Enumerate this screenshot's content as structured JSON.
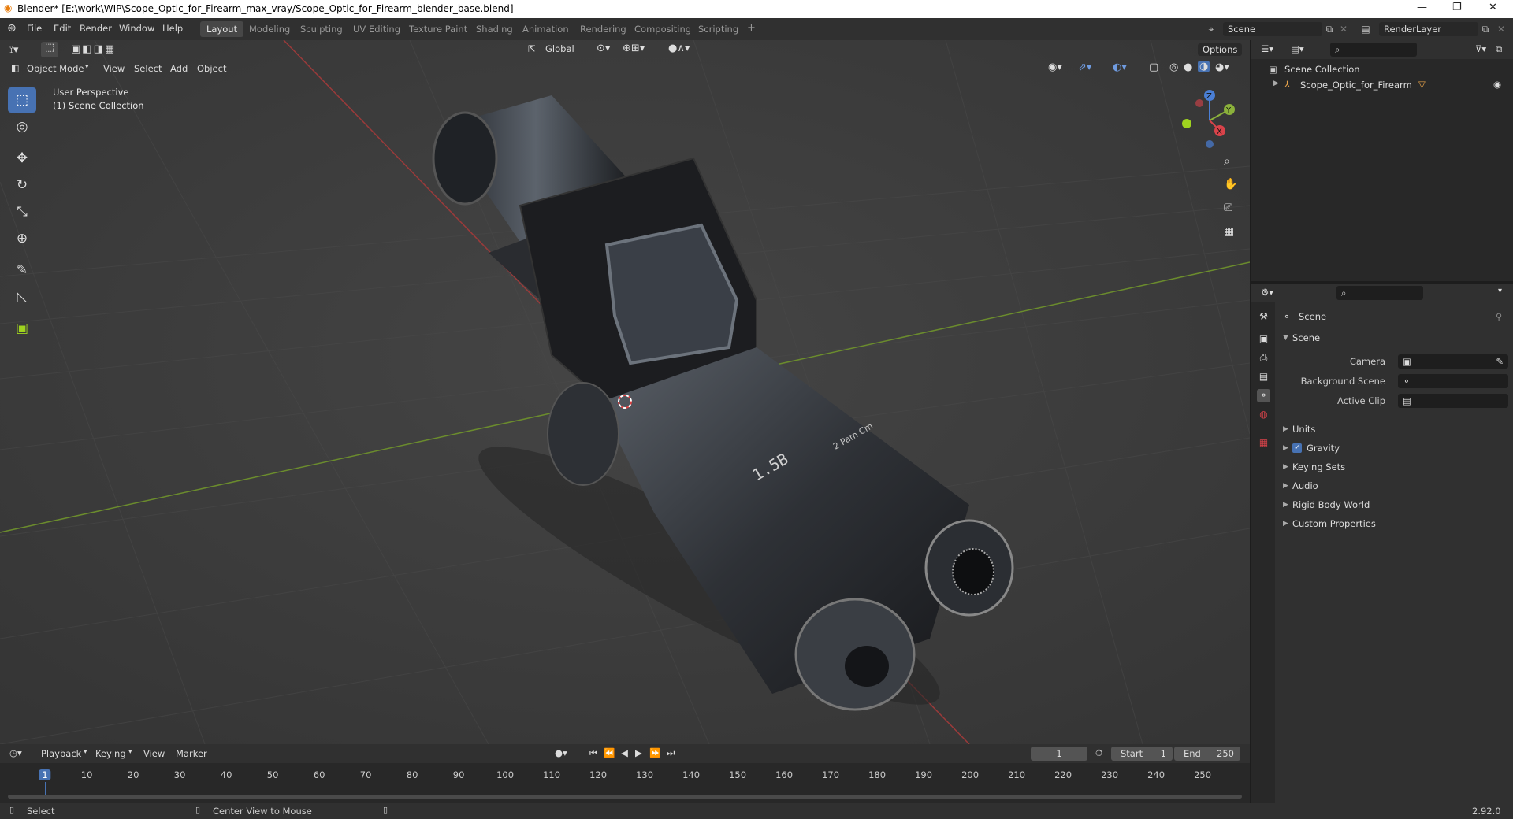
{
  "window": {
    "title": "Blender* [E:\\work\\WIP\\Scope_Optic_for_Firearm_max_vray/Scope_Optic_for_Firearm_blender_base.blend]",
    "controls": {
      "minimize": "—",
      "restore": "❐",
      "close": "✕"
    }
  },
  "menu": [
    "File",
    "Edit",
    "Render",
    "Window",
    "Help"
  ],
  "workspaces": [
    "Layout",
    "Modeling",
    "Sculpting",
    "UV Editing",
    "Texture Paint",
    "Shading",
    "Animation",
    "Rendering",
    "Compositing",
    "Scripting"
  ],
  "active_workspace": "Layout",
  "add_tab": "+",
  "scene_field": "Scene",
  "view_layer_field": "RenderLayer",
  "viewport": {
    "mode": "Object Mode",
    "menus": [
      "View",
      "Select",
      "Add",
      "Object"
    ],
    "orientation": "Global",
    "options": "Options",
    "overlay_perspective": "User Perspective",
    "overlay_collection": "(1) Scene Collection",
    "gizmo_labels": {
      "z": "Z",
      "y": "Y",
      "x": "X"
    },
    "model_text": {
      "label_a": "1.5B",
      "label_b": "2 Pam Cm"
    }
  },
  "outliner": {
    "root": "Scene Collection",
    "item": "Scope_Optic_for_Firearm"
  },
  "properties": {
    "context": "Scene",
    "section": "Scene",
    "fields": [
      {
        "label": "Camera",
        "value": ""
      },
      {
        "label": "Background Scene",
        "value": ""
      },
      {
        "label": "Active Clip",
        "value": ""
      }
    ],
    "panels": [
      "Units",
      "Gravity",
      "Keying Sets",
      "Audio",
      "Rigid Body World",
      "Custom Properties"
    ],
    "gravity_checked": true
  },
  "timeline": {
    "menus": [
      "Playback",
      "Keying",
      "View",
      "Marker"
    ],
    "current_frame": "1",
    "start_label": "Start",
    "start": "1",
    "end_label": "End",
    "end": "250",
    "ruler": [
      "1",
      "10",
      "20",
      "30",
      "40",
      "50",
      "60",
      "70",
      "80",
      "90",
      "100",
      "110",
      "120",
      "130",
      "140",
      "150",
      "160",
      "170",
      "180",
      "190",
      "200",
      "210",
      "220",
      "230",
      "240",
      "250"
    ]
  },
  "status": {
    "left": "Select",
    "middle": "Center View to Mouse",
    "version": "2.92.0"
  },
  "colors": {
    "accent": "#4772b3",
    "x_axis": "#9b3a3a",
    "y_axis": "#6b8c2d",
    "background": "#3d3d3d"
  }
}
